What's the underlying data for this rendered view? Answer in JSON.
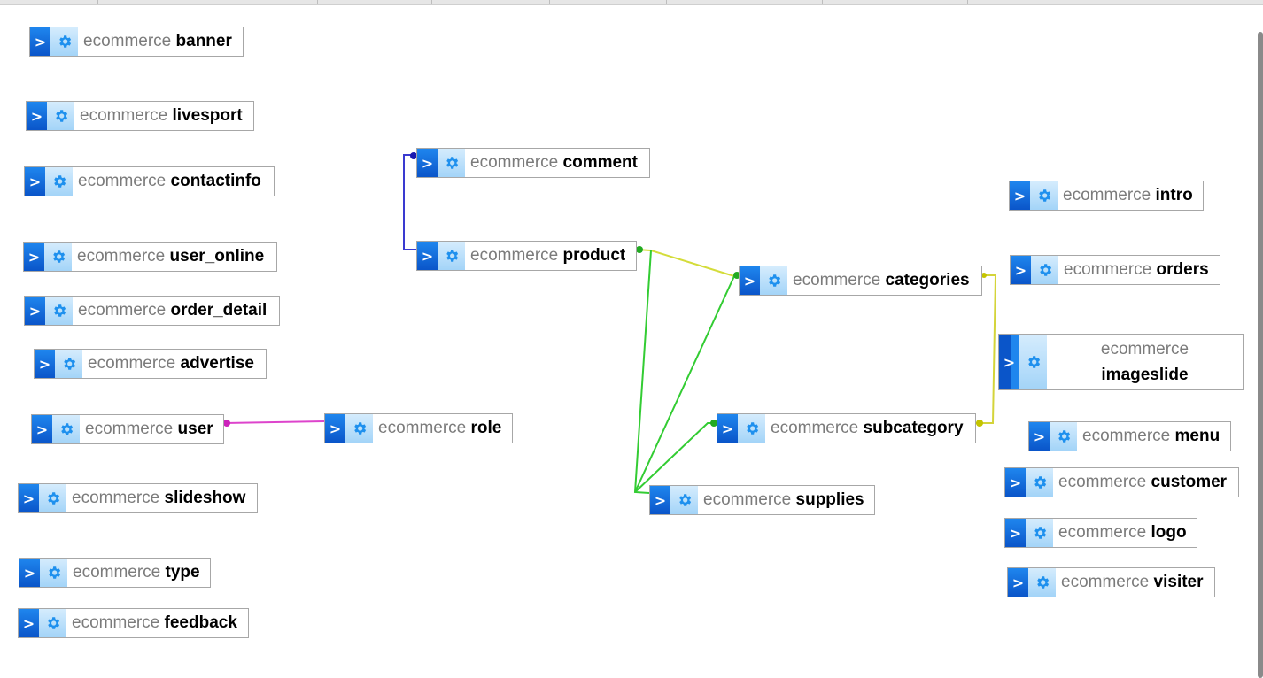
{
  "database": "ecommerce",
  "tables": {
    "banner": {
      "db": "ecommerce",
      "name": "banner"
    },
    "livesport": {
      "db": "ecommerce",
      "name": "livesport"
    },
    "contactinfo": {
      "db": "ecommerce",
      "name": "contactinfo"
    },
    "user_online": {
      "db": "ecommerce",
      "name": "user_online"
    },
    "order_detail": {
      "db": "ecommerce",
      "name": "order_detail"
    },
    "advertise": {
      "db": "ecommerce",
      "name": "advertise"
    },
    "user": {
      "db": "ecommerce",
      "name": "user"
    },
    "slideshow": {
      "db": "ecommerce",
      "name": "slideshow"
    },
    "type": {
      "db": "ecommerce",
      "name": "type"
    },
    "feedback": {
      "db": "ecommerce",
      "name": "feedback"
    },
    "comment": {
      "db": "ecommerce",
      "name": "comment"
    },
    "product": {
      "db": "ecommerce",
      "name": "product"
    },
    "role": {
      "db": "ecommerce",
      "name": "role"
    },
    "categories": {
      "db": "ecommerce",
      "name": "categories"
    },
    "subcategory": {
      "db": "ecommerce",
      "name": "subcategory"
    },
    "supplies": {
      "db": "ecommerce",
      "name": "supplies"
    },
    "intro": {
      "db": "ecommerce",
      "name": "intro"
    },
    "orders": {
      "db": "ecommerce",
      "name": "orders"
    },
    "imageslide": {
      "db": "ecommerce",
      "name": "imageslide"
    },
    "menu": {
      "db": "ecommerce",
      "name": "menu"
    },
    "customer": {
      "db": "ecommerce",
      "name": "customer"
    },
    "logo": {
      "db": "ecommerce",
      "name": "logo"
    },
    "visiter": {
      "db": "ecommerce",
      "name": "visiter"
    }
  },
  "icons": {
    "expand": "chevron-right-icon",
    "options": "gear-icon"
  },
  "colors": {
    "relation_comment_product": "#3a3ad0",
    "relation_user_role": "#dd33cc",
    "relation_product_categories": "#d4dc3a",
    "relation_categories_subcategory": "#d4d43a",
    "relation_supplies": "#33cc33",
    "expand_button": "#0a55c9",
    "gear_button": "#a3d4f8"
  }
}
